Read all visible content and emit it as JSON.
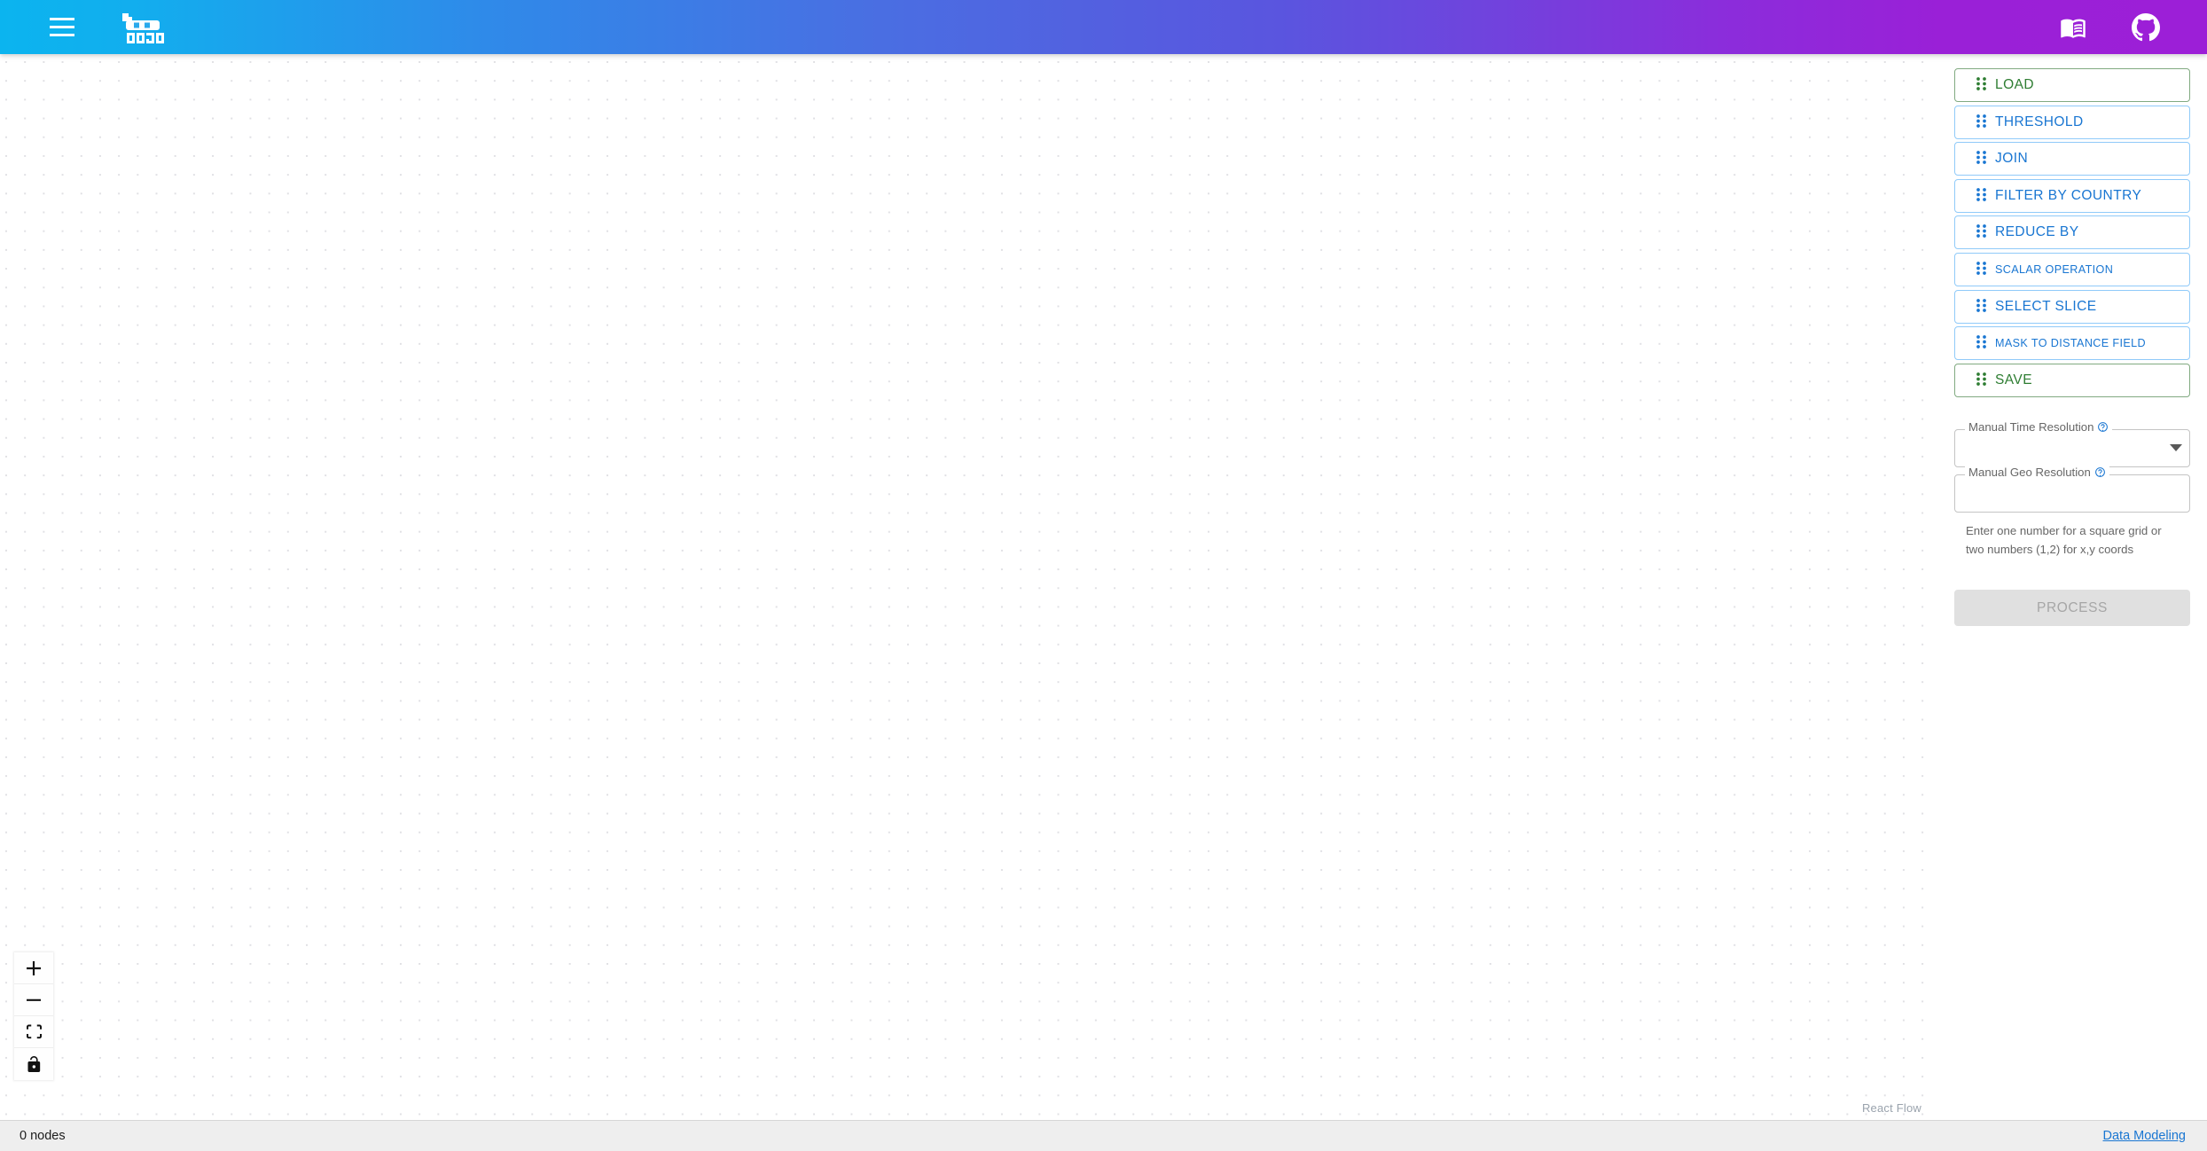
{
  "header": {
    "menu_icon": "hamburger-menu-icon",
    "logo_text": "DOJO",
    "logo_icon": "dojo-pixel-logo",
    "actions": [
      {
        "name": "documentation",
        "icon": "book-icon",
        "label": "Documentation"
      },
      {
        "name": "github",
        "icon": "github-icon",
        "label": "GitHub"
      }
    ],
    "gradient": {
      "from": "#0bb4ef",
      "mid": "#5360e0",
      "to": "#9c1fd7"
    }
  },
  "sidebar": {
    "drag_handle_icon": "drag-dots-icon",
    "operations": [
      {
        "label": "Load",
        "color": "green",
        "size": "normal"
      },
      {
        "label": "Threshold",
        "color": "blue",
        "size": "normal"
      },
      {
        "label": "Join",
        "color": "blue",
        "size": "normal"
      },
      {
        "label": "Filter by Country",
        "color": "blue",
        "size": "normal"
      },
      {
        "label": "Reduce By",
        "color": "blue",
        "size": "normal"
      },
      {
        "label": "Scalar Operation",
        "color": "blue",
        "size": "small"
      },
      {
        "label": "Select Slice",
        "color": "blue",
        "size": "normal"
      },
      {
        "label": "Mask to Distance Field",
        "color": "blue",
        "size": "small"
      },
      {
        "label": "Save",
        "color": "green",
        "size": "normal"
      }
    ],
    "fields": {
      "time_resolution": {
        "label": "Manual Time Resolution",
        "value": "",
        "placeholder": "",
        "help_icon": "help-circle-icon",
        "type": "select"
      },
      "geo_resolution": {
        "label": "Manual Geo Resolution",
        "value": "",
        "placeholder": "",
        "help_icon": "help-circle-icon",
        "type": "text",
        "helper_text": "Enter one number for a square grid or two numbers (1,2) for x,y coords"
      }
    },
    "process_button": {
      "label": "Process",
      "disabled": true
    },
    "colors": {
      "blue": "#1976d2",
      "green": "#2e7d32",
      "border_blue": "#90caf9",
      "border_green": "#81aa81"
    }
  },
  "canvas": {
    "controls": [
      {
        "name": "zoom-in",
        "icon": "plus-icon"
      },
      {
        "name": "zoom-out",
        "icon": "minus-icon"
      },
      {
        "name": "fit-view",
        "icon": "fit-view-icon"
      },
      {
        "name": "toggle-interactivity",
        "icon": "unlock-icon"
      }
    ],
    "attribution": "React Flow"
  },
  "footer": {
    "node_count": "0 nodes",
    "link_label": "Data Modeling"
  }
}
